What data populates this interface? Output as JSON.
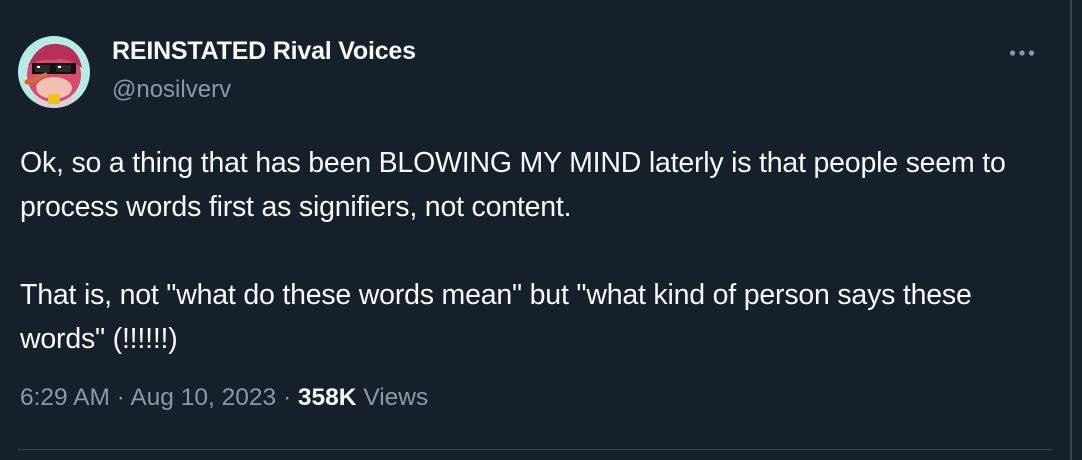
{
  "author": {
    "display_name": "REINSTATED Rival Voices",
    "handle": "@nosilverv"
  },
  "tweet": {
    "paragraphs": [
      "Ok, so a thing that has been BLOWING MY MIND laterly is that people seem to process words first as signifiers, not content.",
      "That is, not \"what do these words mean\" but \"what kind of person says these words\" (!!!!!!)"
    ]
  },
  "meta": {
    "time": "6:29 AM",
    "separator": "·",
    "date": "Aug 10, 2023",
    "views_count": "358K",
    "views_label": "Views"
  },
  "icons": {
    "more": "more-horizontal-icon",
    "avatar": "avatar-cartoon-with-sunglasses"
  },
  "colors": {
    "background": "#15202b",
    "primary_text": "#f7f9f9",
    "secondary_text": "#8b98a5",
    "border": "#38444d"
  }
}
